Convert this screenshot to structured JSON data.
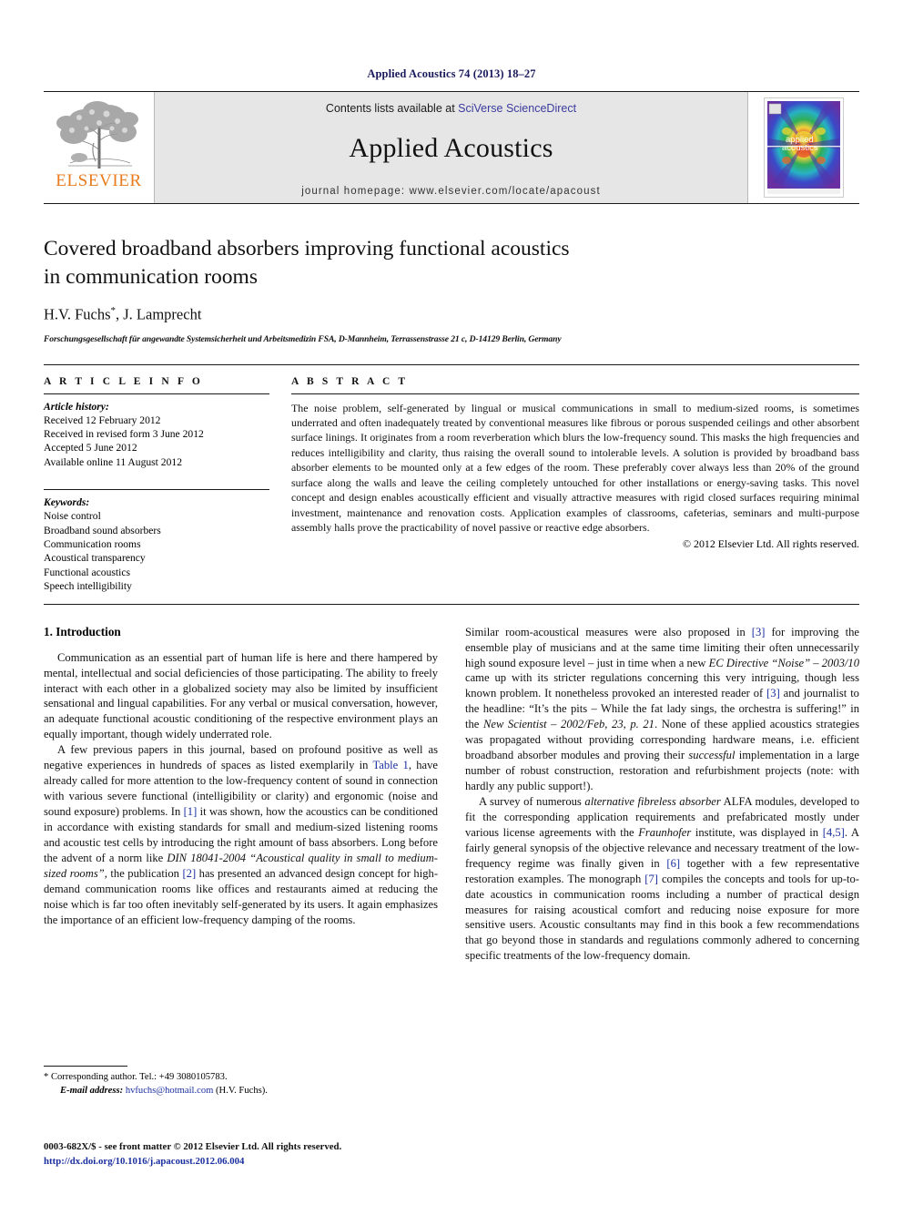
{
  "running_head": "Applied Acoustics 74 (2013) 18–27",
  "masthead": {
    "publisher_name": "ELSEVIER",
    "contents_prefix": "Contents lists available at ",
    "contents_link": "SciVerse ScienceDirect",
    "journal_title": "Applied Acoustics",
    "homepage_label": "journal homepage: www.elsevier.com/locate/apacoust",
    "cover_title_line1": "applied",
    "cover_title_line2": "acoustics"
  },
  "article": {
    "title_line1": "Covered broadband absorbers improving functional acoustics",
    "title_line2": "in communication rooms",
    "authors": "H.V. Fuchs",
    "authors_rest": ", J. Lamprecht",
    "corresponding_marker": "*",
    "affiliation": "Forschungsgesellschaft für angewandte Systemsicherheit und Arbeitsmedizin FSA, D-Mannheim, Terrassenstrasse 21 c, D-14129 Berlin, Germany"
  },
  "article_info": {
    "heading": "A R T I C L E   I N F O",
    "history_label": "Article history:",
    "history": [
      "Received 12 February 2012",
      "Received in revised form 3 June 2012",
      "Accepted 5 June 2012",
      "Available online 11 August 2012"
    ],
    "keywords_label": "Keywords:",
    "keywords": [
      "Noise control",
      "Broadband sound absorbers",
      "Communication rooms",
      "Acoustical transparency",
      "Functional acoustics",
      "Speech intelligibility"
    ]
  },
  "abstract": {
    "heading": "A B S T R A C T",
    "text": "The noise problem, self-generated by lingual or musical communications in small to medium-sized rooms, is sometimes underrated and often inadequately treated by conventional measures like fibrous or porous suspended ceilings and other absorbent surface linings. It originates from a room reverberation which blurs the low-frequency sound. This masks the high frequencies and reduces intelligibility and clarity, thus raising the overall sound to intolerable levels. A solution is provided by broadband bass absorber elements to be mounted only at a few edges of the room. These preferably cover always less than 20% of the ground surface along the walls and leave the ceiling completely untouched for other installations or energy-saving tasks. This novel concept and design enables acoustically efficient and visually attractive measures with rigid closed surfaces requiring minimal investment, maintenance and renovation costs. Application examples of classrooms, cafeterias, seminars and multi-purpose assembly halls prove the practicability of novel passive or reactive edge absorbers.",
    "copyright": "© 2012 Elsevier Ltd. All rights reserved."
  },
  "body": {
    "section_title": "1. Introduction",
    "left_para_1": "Communication as an essential part of human life is here and there hampered by mental, intellectual and social deficiencies of those participating. The ability to freely interact with each other in a globalized society may also be limited by insufficient sensational and lingual capabilities. For any verbal or musical conversation, however, an adequate functional acoustic conditioning of the respective environment plays an equally important, though widely underrated role.",
    "left_para_2_a": "A few previous papers in this journal, based on profound positive as well as negative experiences in hundreds of spaces as listed exemplarily in ",
    "left_para_2_link1": "Table 1",
    "left_para_2_b": ", have already called for more attention to the low-frequency content of sound in connection with various severe functional (intelligibility or clarity) and ergonomic (noise and sound exposure) problems. In ",
    "left_para_2_link2": "[1]",
    "left_para_2_c": " it was shown, how the acoustics can be conditioned in accordance with existing standards for small and medium-sized listening rooms and acoustic test cells by introducing the right amount of bass absorbers. Long before the advent of a norm like ",
    "left_para_2_ital1": "DIN 18041-2004 “Acoustical quality in small to medium-sized rooms”",
    "left_para_2_d": ", the publication ",
    "left_para_2_link3": "[2]",
    "left_para_2_e": " has presented an advanced design concept for high-demand communication rooms like offices and restaurants aimed at reducing the noise which is far too often inevitably self-generated by its users. It again emphasizes the importance of an efficient low-frequency damping of the rooms.",
    "right_para_1_a": "Similar room-acoustical measures were also proposed in ",
    "right_para_1_link1": "[3]",
    "right_para_1_b": " for improving the ensemble play of musicians and at the same time limiting their often unnecessarily high sound exposure level – just in time when a new ",
    "right_para_1_ital1": "EC Directive “Noise” – 2003/10",
    "right_para_1_c": " came up with its stricter regulations concerning this very intriguing, though less known problem. It nonetheless provoked an interested reader of ",
    "right_para_1_link2": "[3]",
    "right_para_1_d": " and journalist to the headline: “It’s the pits – While the fat lady sings, the orchestra is suffering!” in the ",
    "right_para_1_ital2": "New Scientist – 2002/Feb, 23, p. 21",
    "right_para_1_e": ". None of these applied acoustics strategies was propagated without providing corresponding hardware means, i.e. efficient broadband absorber modules and proving their ",
    "right_para_1_ital3": "successful",
    "right_para_1_f": " implementation in a large number of robust construction, restoration and refurbishment projects (note: with hardly any public support!).",
    "right_para_2_a": "A survey of numerous ",
    "right_para_2_ital1": "alternative fibreless absorber",
    "right_para_2_b": " ALFA modules, developed to fit the corresponding application requirements and prefabricated mostly under various license agreements with the ",
    "right_para_2_ital2": "Fraunhofer",
    "right_para_2_c": " institute, was displayed in ",
    "right_para_2_link1": "[4,5]",
    "right_para_2_d": ". A fairly general synopsis of the objective relevance and necessary treatment of the low-frequency regime was finally given in ",
    "right_para_2_link2": "[6]",
    "right_para_2_e": " together with a few representative restoration examples. The monograph ",
    "right_para_2_link3": "[7]",
    "right_para_2_f": " compiles the concepts and tools for up-to-date acoustics in communication rooms including a number of practical design measures for raising acoustical comfort and reducing noise exposure for more sensitive users. Acoustic consultants may find in this book a few recommendations that go beyond those in standards and regulations commonly adhered to concerning specific treatments of the low-frequency domain."
  },
  "footnote": {
    "marker": "*",
    "corresponding": " Corresponding author. Tel.: +49 3080105783.",
    "email_label": "E-mail address:",
    "email": "hvfuchs@hotmail.com",
    "email_owner": " (H.V. Fuchs)."
  },
  "footer": {
    "issn_line": "0003-682X/$ - see front matter © 2012 Elsevier Ltd. All rights reserved.",
    "doi": "http://dx.doi.org/10.1016/j.apacoust.2012.06.004"
  },
  "colors": {
    "link_blue": "#1a2fa0",
    "sciencedirect_blue": "#3b3b9e",
    "elsevier_orange": "#E87B1E",
    "band_gray": "#e6e6e6"
  }
}
